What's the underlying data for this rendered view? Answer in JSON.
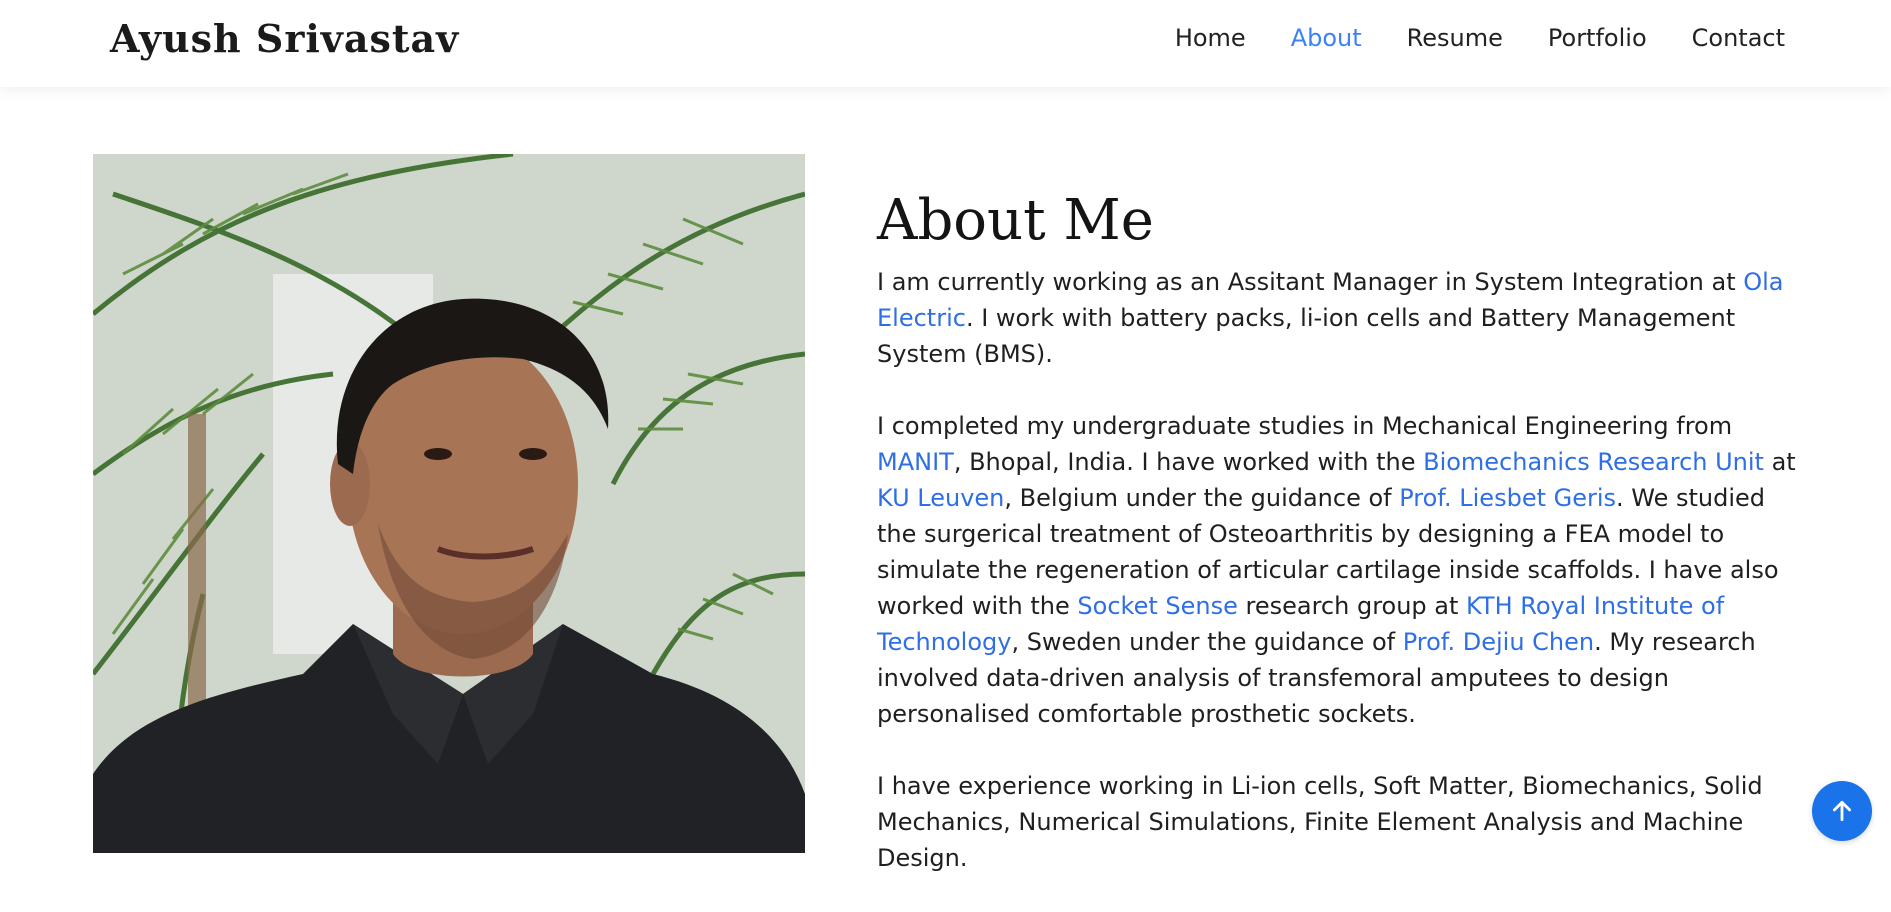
{
  "header": {
    "brand": "Ayush Srivastav",
    "nav": [
      {
        "label": "Home"
      },
      {
        "label": "About",
        "active": true
      },
      {
        "label": "Resume"
      },
      {
        "label": "Portfolio"
      },
      {
        "label": "Contact"
      }
    ]
  },
  "about": {
    "title": "About Me",
    "p1": {
      "t1": "I am currently working as an Assitant Manager in System Integration at ",
      "link_ola": "Ola Electric",
      "t2": ". I work with battery packs, li-ion cells and Battery Management System (BMS)."
    },
    "p2": {
      "t1": "I completed my undergraduate studies in Mechanical Engineering from ",
      "link_manit": "MANIT",
      "t2": ", Bhopal, India. I have worked with the ",
      "link_bru": "Biomechanics Research Unit",
      "t3": " at ",
      "link_kul": "KU Leuven",
      "t4": ", Belgium under the guidance of ",
      "link_geris": "Prof. Liesbet Geris",
      "t5": ". We studied the surgerical treatment of Osteoarthritis by designing a FEA model to simulate the regeneration of articular cartilage inside scaffolds. I have also worked with the ",
      "link_socket": "Socket Sense",
      "t6": " research group at ",
      "link_kth": "KTH Royal Institute of Technology",
      "t7": ", Sweden under the guidance of ",
      "link_chen": "Prof. Dejiu Chen",
      "t8": ". My research involved data-driven analysis of transfemoral amputees to design personalised comfortable prosthetic sockets."
    },
    "p3": "I have experience working in Li-ion cells, Soft Matter, Biomechanics, Solid Mechanics, Numerical Simulations, Finite Element Analysis and Machine Design."
  },
  "scroll_top": {
    "icon": "arrow-up-icon"
  },
  "colors": {
    "link": "#2f6fe4",
    "nav_active": "#3b82f6",
    "scroll_button": "#1a73e8"
  }
}
